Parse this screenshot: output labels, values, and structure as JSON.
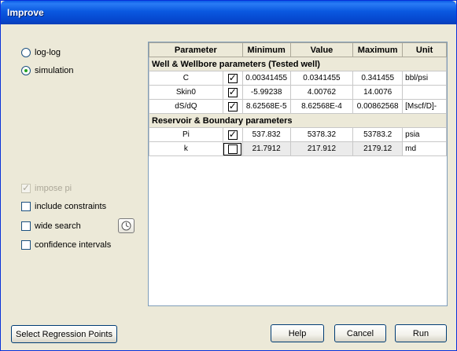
{
  "window": {
    "title": "Improve"
  },
  "options": {
    "log_log": {
      "label": "log-log",
      "selected": false
    },
    "simulation": {
      "label": "simulation",
      "selected": true
    },
    "impose_pi": {
      "label": "impose pi",
      "checked": true,
      "enabled": false
    },
    "include_constraints": {
      "label": "include constraints",
      "checked": false
    },
    "wide_search": {
      "label": "wide search",
      "checked": false
    },
    "confidence_intervals": {
      "label": "confidence intervals",
      "checked": false
    }
  },
  "table": {
    "headers": {
      "parameter": "Parameter",
      "minimum": "Minimum",
      "value": "Value",
      "maximum": "Maximum",
      "unit": "Unit"
    },
    "groups": [
      {
        "title": "Well & Wellbore parameters (Tested well)",
        "rows": [
          {
            "name": "C",
            "checked": true,
            "minimum": "0.00341455",
            "value": "0.0341455",
            "maximum": "0.341455",
            "unit": "bbl/psi"
          },
          {
            "name": "Skin0",
            "checked": true,
            "minimum": "-5.99238",
            "value": "4.00762",
            "maximum": "14.0076",
            "unit": ""
          },
          {
            "name": "dS/dQ",
            "checked": true,
            "minimum": "8.62568E-5",
            "value": "8.62568E-4",
            "maximum": "0.00862568",
            "unit": "[Mscf/D]-"
          }
        ]
      },
      {
        "title": "Reservoir & Boundary parameters",
        "rows": [
          {
            "name": "Pi",
            "checked": true,
            "minimum": "537.832",
            "value": "5378.32",
            "maximum": "53783.2",
            "unit": "psia"
          },
          {
            "name": "k",
            "checked": false,
            "minimum": "21.7912",
            "value": "217.912",
            "maximum": "2179.12",
            "unit": "md"
          }
        ]
      }
    ]
  },
  "buttons": {
    "select_regression": "Select Regression Points",
    "help": "Help",
    "cancel": "Cancel",
    "run": "Run"
  }
}
